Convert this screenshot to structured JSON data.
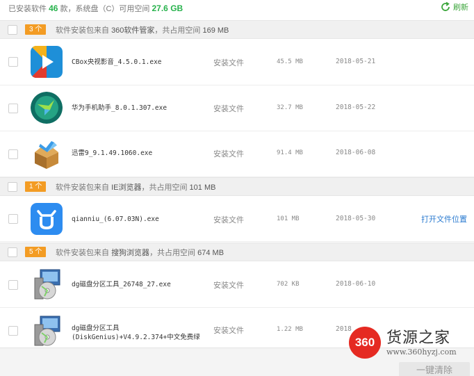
{
  "summary": {
    "prefix": "已安装软件",
    "count": "46",
    "mid": "款，系统盘（C）可用空间",
    "free": "27.6 GB"
  },
  "refresh_label": "刷新",
  "groups": [
    {
      "badge": "3 个",
      "prefix": "软件安装包来自",
      "source": "360软件管家",
      "mid": "，共占用空间",
      "size": "169 MB"
    },
    {
      "badge": "1 个",
      "prefix": "软件安装包来自",
      "source": "IE浏览器",
      "mid": "，共占用空间",
      "size": "101 MB"
    },
    {
      "badge": "5 个",
      "prefix": "软件安装包来自",
      "source": "搜狗浏览器",
      "mid": "，共占用空间",
      "size": "674 MB"
    }
  ],
  "files": [
    {
      "name": "CBox央视影音_4.5.0.1.exe",
      "type": "安装文件",
      "size": "45.5 MB",
      "date": "2018-05-21",
      "icon": "cbox-icon"
    },
    {
      "name": "华为手机助手_8.0.1.307.exe",
      "type": "安装文件",
      "size": "32.7 MB",
      "date": "2018-05-22",
      "icon": "huawei-hisuite-icon"
    },
    {
      "name": "迅雷9_9.1.49.1060.exe",
      "type": "安装文件",
      "size": "91.4 MB",
      "date": "2018-06-08",
      "icon": "xunlei-icon"
    },
    {
      "name": "qianniu_(6.07.03N).exe",
      "type": "安装文件",
      "size": "101 MB",
      "date": "2018-05-30",
      "icon": "qianniu-icon",
      "action": "打开文件位置"
    },
    {
      "name": "dg磁盘分区工具_26748_27.exe",
      "type": "安装文件",
      "size": "702 KB",
      "date": "2018-06-10",
      "icon": "installer-cd-icon"
    },
    {
      "name": "dg磁盘分区工具",
      "name2": "(DiskGenius)+V4.9.2.374+中文免费绿",
      "type": "安装文件",
      "size": "1.22 MB",
      "date": "2018",
      "icon": "installer-cd-icon"
    }
  ],
  "footer": {
    "clean_label": "一键清除"
  },
  "watermark": {
    "logo": "360",
    "name": "货源之家",
    "url": "www.360hyzj.com"
  },
  "colors": {
    "accent_green": "#27b24c",
    "badge_orange": "#f39c24",
    "link_blue": "#2b7bd0"
  }
}
